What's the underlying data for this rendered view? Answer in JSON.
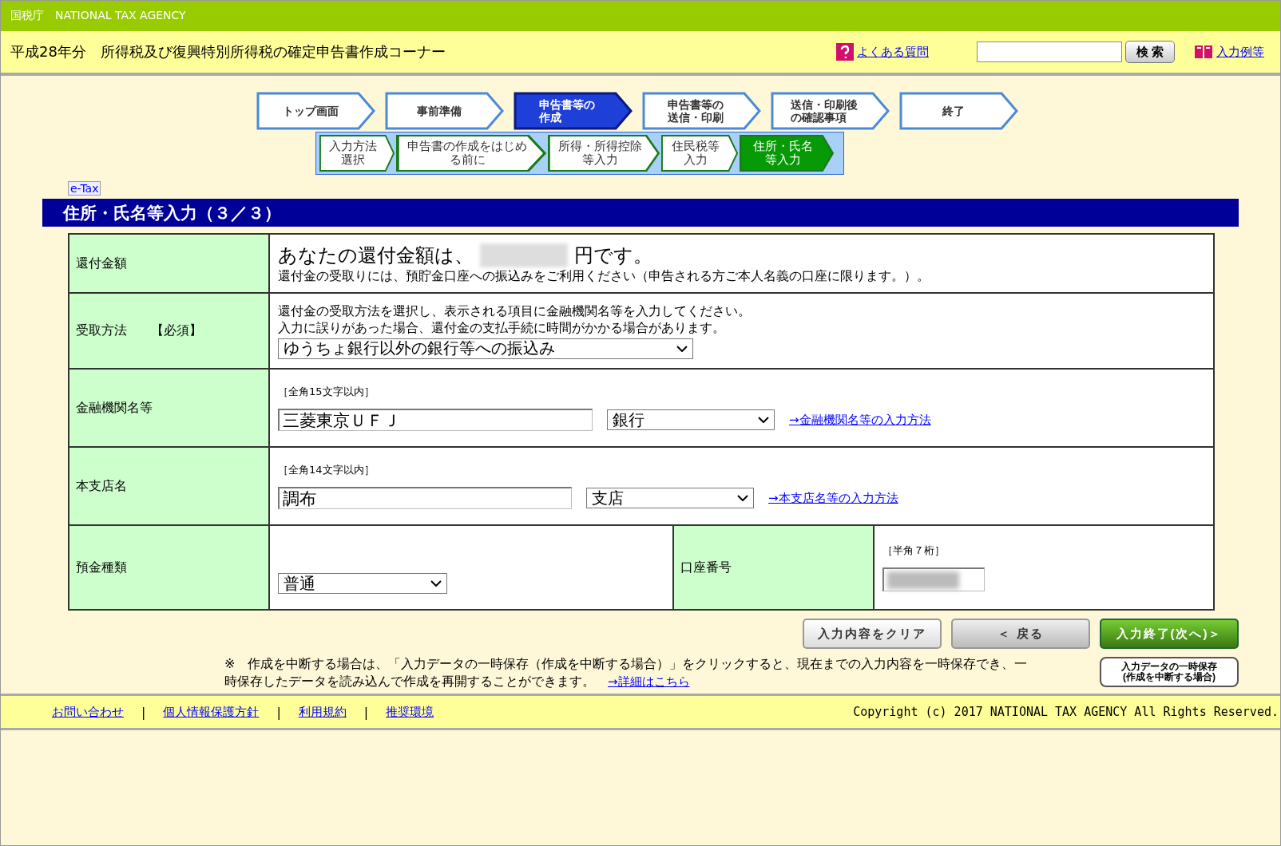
{
  "agency_bar": {
    "title": "国税庁　NATIONAL TAX AGENCY"
  },
  "header": {
    "title": "平成28年分　所得税及び復興特別所得税の確定申告書作成コーナー",
    "faq_link": "よくある質問",
    "search": {
      "button": "検 索"
    },
    "examples_link": "入力例等"
  },
  "steps": [
    {
      "label": "トップ画面",
      "selected": false
    },
    {
      "label": "事前準備",
      "selected": false
    },
    {
      "label": "申告書等の作成",
      "selected": true
    },
    {
      "label": "申告書等の送信・印刷",
      "selected": false
    },
    {
      "label": "送信・印刷後の確認事項",
      "selected": false
    },
    {
      "label": "終了",
      "selected": false
    }
  ],
  "substeps": [
    {
      "label": "入力方法選択",
      "selected": false
    },
    {
      "label": "申告書の作成をはじめる前に",
      "selected": false
    },
    {
      "label": "所得・所得控除等入力",
      "selected": false
    },
    {
      "label": "住民税等入力",
      "selected": false
    },
    {
      "label": "住所・氏名等入力",
      "selected": true
    }
  ],
  "etax_badge": "e-Tax",
  "section_title": "住所・氏名等入力（３／３）",
  "form": {
    "refund": {
      "label": "還付金額",
      "prefix": "あなたの還付金額は、",
      "suffix": "円です。",
      "note": "還付金の受取りには、預貯金口座への振込みをご利用ください（申告される方ご本人名義の口座に限ります。）。"
    },
    "method": {
      "label": "受取方法",
      "required": "【必須】",
      "instructions": [
        "還付金の受取方法を選択し、表示される項目に金融機関名等を入力してください。",
        "入力に誤りがあった場合、還付金の支払手続に時間がかかる場合があります。"
      ],
      "select": "ゆうちょ銀行以外の銀行等への振込み"
    },
    "bank": {
      "label": "金融機関名等",
      "hint": "［全角15文字以内］",
      "value": "三菱東京ＵＦＪ",
      "select": "銀行",
      "link": "→金融機関名等の入力方法"
    },
    "branch": {
      "label": "本支店名",
      "hint": "［全角14文字以内］",
      "value": "調布",
      "select": "支店",
      "link": "→本支店名等の入力方法"
    },
    "deposit": {
      "label": "預金種類",
      "select": "普通"
    },
    "account": {
      "label": "口座番号",
      "hint": "［半角７桁］"
    }
  },
  "buttons": {
    "clear": "入力内容をクリア",
    "back": "＜ 戻る",
    "next": "入力終了(次へ)＞",
    "save": "入力データの一時保存\n(作成を中断する場合)"
  },
  "note": {
    "text": "※　作成を中断する場合は、「入力データの一時保存（作成を中断する場合）」をクリックすると、現在までの入力内容を一時保存でき、一時保存したデータを読み込んで作成を再開することができます。　",
    "link": "→詳細はこちら"
  },
  "footer": {
    "links": [
      "お問い合わせ",
      "個人情報保護方針",
      "利用規約",
      "推奨環境"
    ],
    "separator": "|",
    "copyright": "Copyright (c) 2017 NATIONAL TAX AGENCY All Rights Reserved."
  }
}
